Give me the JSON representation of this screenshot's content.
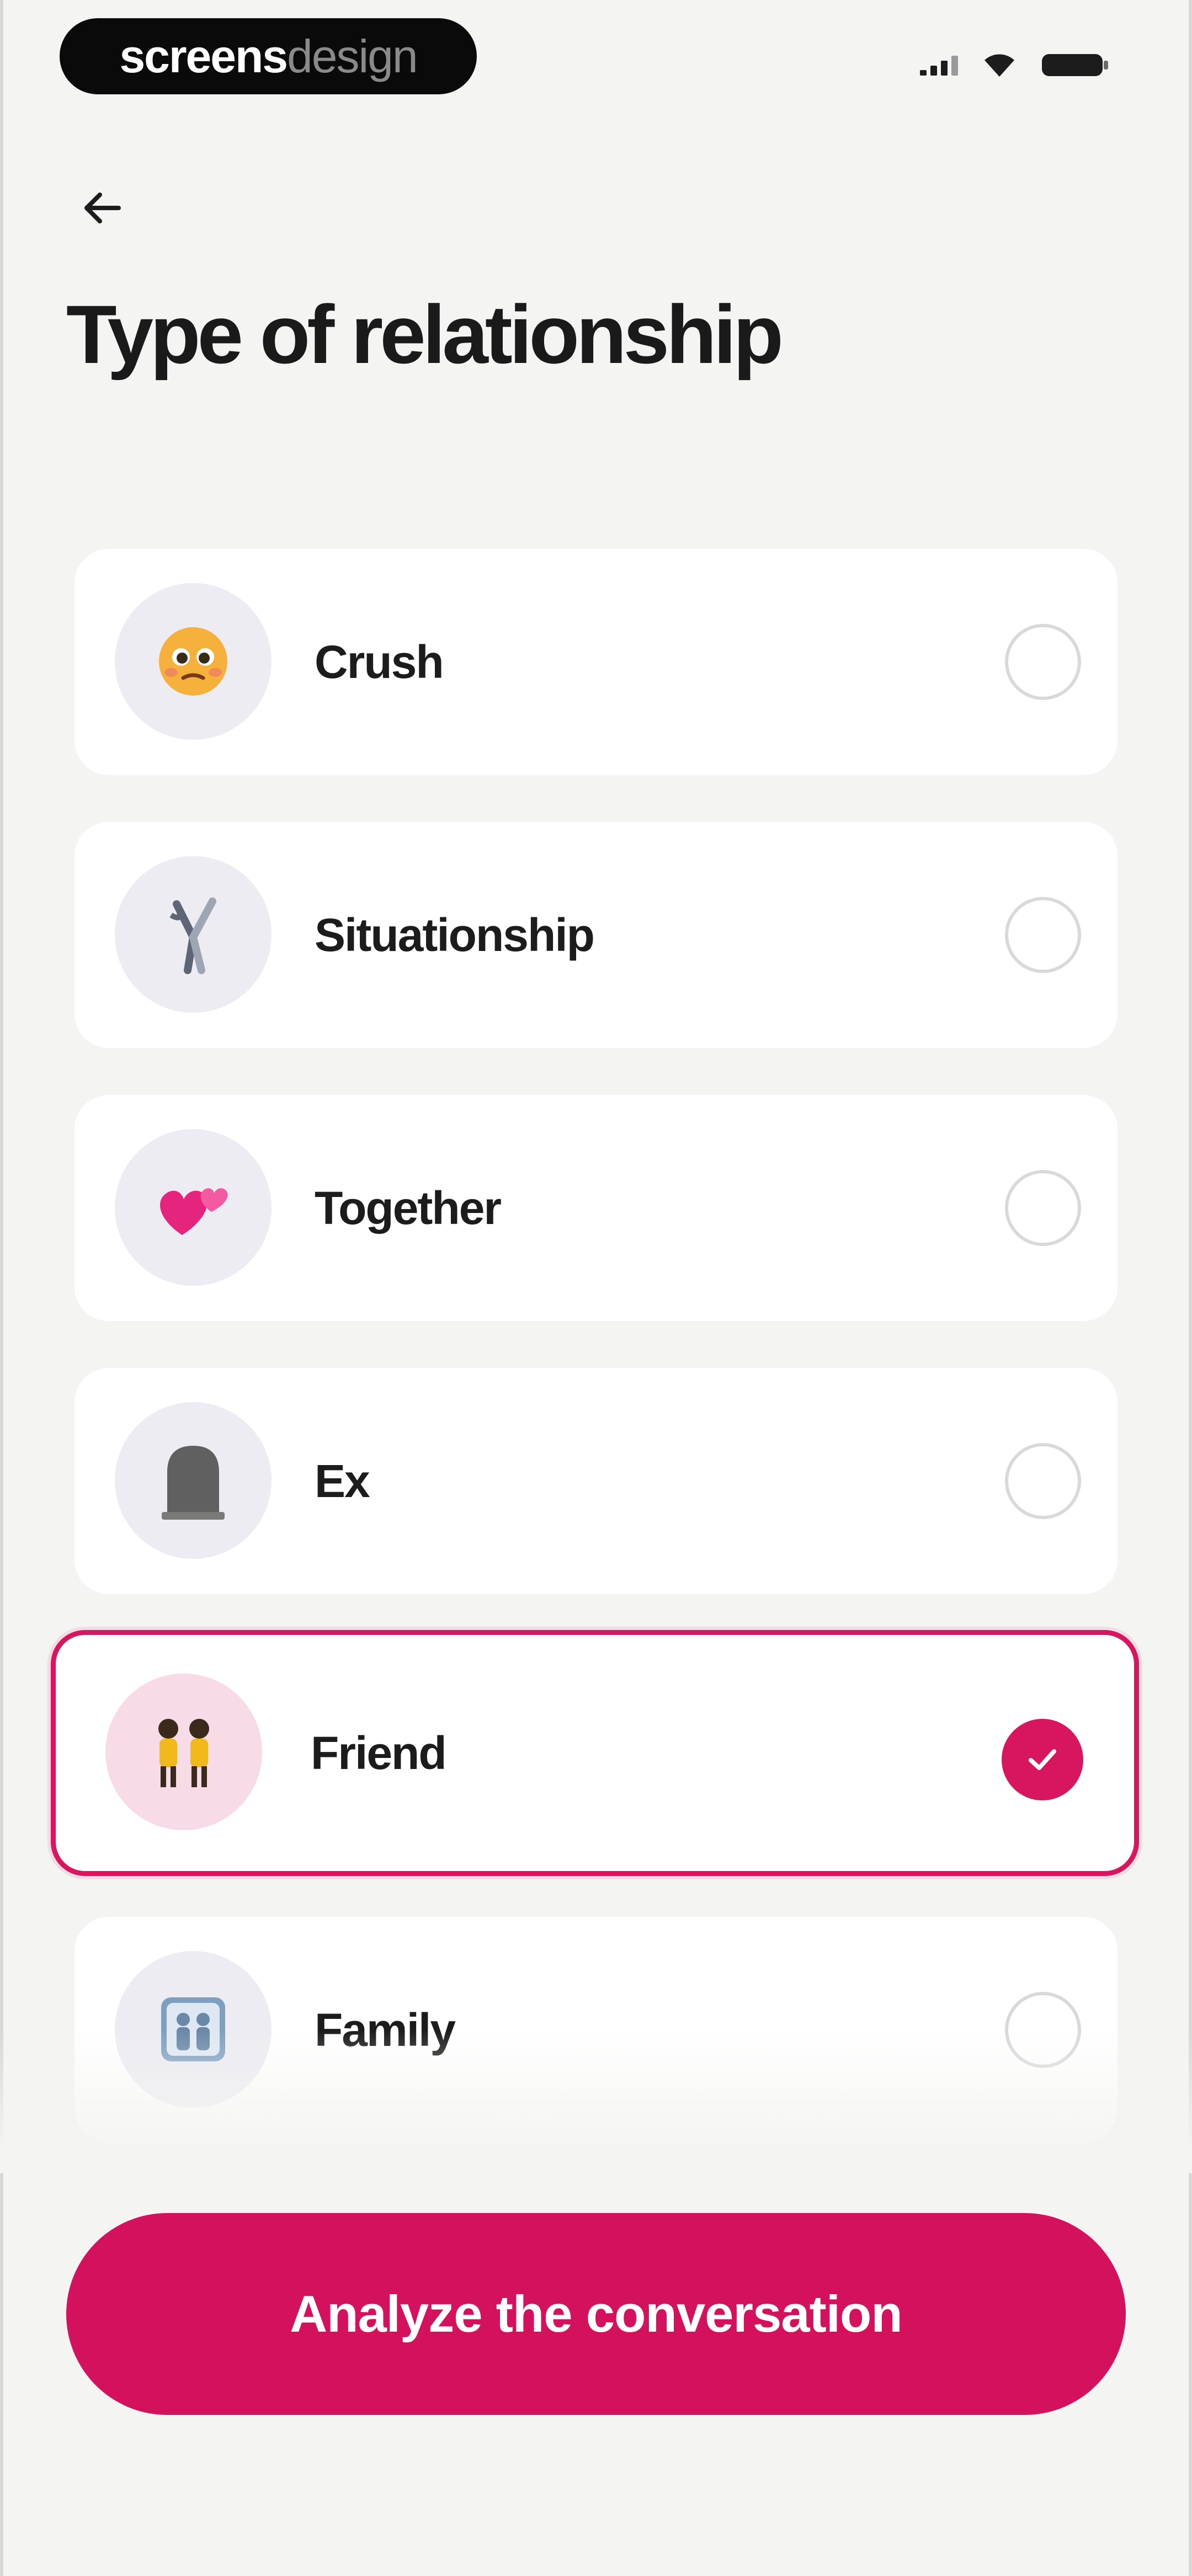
{
  "status_bar": {
    "brand_part1": "screens",
    "brand_part2": "design"
  },
  "header": {
    "title": "Type of relationship"
  },
  "options": [
    {
      "label": "Crush",
      "icon": "pleading-face-icon",
      "selected": false
    },
    {
      "label": "Situationship",
      "icon": "tangled-ribbon-icon",
      "selected": false
    },
    {
      "label": "Together",
      "icon": "two-hearts-icon",
      "selected": false
    },
    {
      "label": "Ex",
      "icon": "headstone-icon",
      "selected": false
    },
    {
      "label": "Friend",
      "icon": "two-people-icon",
      "selected": true
    },
    {
      "label": "Family",
      "icon": "family-icon",
      "selected": false
    }
  ],
  "cta": {
    "label": "Analyze the conversation"
  },
  "colors": {
    "accent": "#d4115c",
    "background": "#f4f4f2",
    "card": "#ffffff",
    "icon_bg": "#ececf2",
    "selected_icon_bg": "#f7dbe7"
  }
}
